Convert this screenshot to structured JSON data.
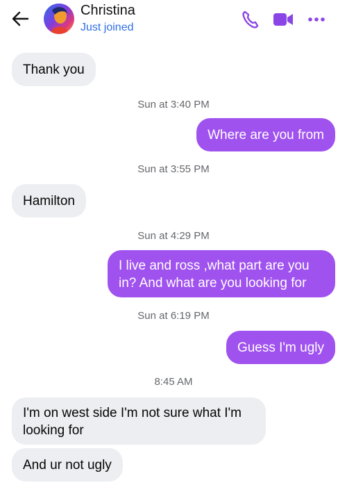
{
  "header": {
    "contact_name": "Christina",
    "status": "Just joined",
    "accent": "#8a45e6"
  },
  "messages": [
    {
      "direction": "in",
      "text": "Thank you"
    },
    {
      "timestamp": "Sun at 3:40 PM"
    },
    {
      "direction": "out",
      "text": "Where are you from"
    },
    {
      "timestamp": "Sun at 3:55 PM"
    },
    {
      "direction": "in",
      "text": "Hamilton"
    },
    {
      "timestamp": "Sun at 4:29 PM"
    },
    {
      "direction": "out",
      "text": "I live and ross ,what part are you in? And what are you looking for"
    },
    {
      "timestamp": "Sun at 6:19 PM"
    },
    {
      "direction": "out",
      "text": "Guess I'm ugly"
    },
    {
      "timestamp": "8:45 AM"
    },
    {
      "direction": "in",
      "text": "I'm on west side I'm not sure what I'm looking for"
    },
    {
      "direction": "in",
      "text": "And ur not ugly"
    }
  ],
  "colors": {
    "outgoing_bubble": "#a052ef",
    "incoming_bubble": "#eceef1",
    "timestamp_text": "#65676b",
    "status_text": "#2f6fe4"
  },
  "icons": [
    "back-arrow-icon",
    "phone-icon",
    "video-camera-icon",
    "more-options-icon"
  ]
}
